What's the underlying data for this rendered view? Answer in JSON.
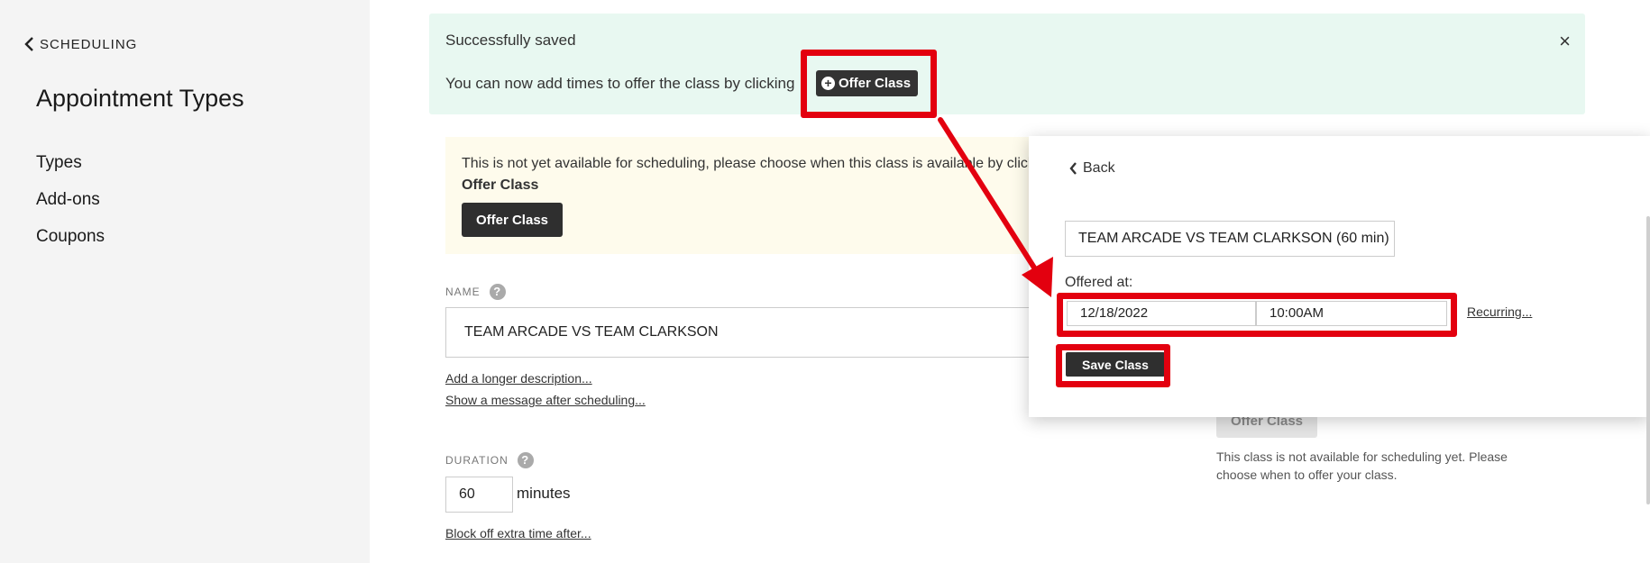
{
  "sidebar": {
    "back_label": "SCHEDULING",
    "title": "Appointment Types",
    "items": [
      {
        "label": "Types"
      },
      {
        "label": "Add-ons"
      },
      {
        "label": "Coupons"
      }
    ]
  },
  "success_banner": {
    "title": "Successfully saved",
    "message": "You can now add times to offer the class by clicking",
    "inline_button": "Offer Class",
    "close_glyph": "×"
  },
  "warning_banner": {
    "text": "This is not yet available for scheduling, please choose when this class is available by clicking",
    "text_bold": "Offer Class",
    "button": "Offer Class"
  },
  "form": {
    "name_label": "NAME",
    "name_value": "TEAM ARCADE VS TEAM CLARKSON",
    "add_description_link": "Add a longer description...",
    "show_message_link": "Show a message after scheduling...",
    "duration_label": "DURATION",
    "duration_value": "60",
    "duration_unit": "minutes",
    "block_time_link": "Block off extra time after...",
    "help_glyph": "?"
  },
  "right_column": {
    "button": "Offer Class",
    "note": "This class is not available for scheduling yet. Please choose when to offer your class."
  },
  "popup": {
    "back_label": "Back",
    "class_select": "TEAM ARCADE VS TEAM CLARKSON (60 min)",
    "offered_at_label": "Offered at:",
    "date_value": "12/18/2022",
    "time_value": "10:00AM",
    "recurring_link": "Recurring...",
    "save_button": "Save Class"
  },
  "colors": {
    "highlight": "#e3000f",
    "success_bg": "#e8f8f1",
    "warning_bg": "#fefbec",
    "button_dark": "#2f2f2f"
  }
}
